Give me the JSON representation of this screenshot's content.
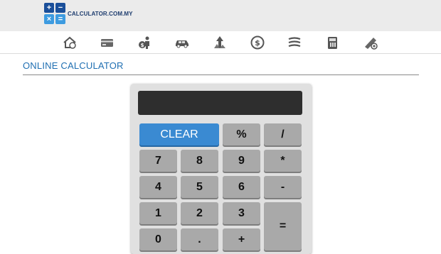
{
  "header": {
    "logo_symbols": [
      "+",
      "−",
      "×",
      "="
    ],
    "logo_text": "CALCULATOR.COM.MY",
    "colors": {
      "brand_dark": "#1a4f9a",
      "brand_light": "#3d9be0"
    }
  },
  "nav_icons": [
    "home-icon",
    "credit-card-icon",
    "salary-icon",
    "car-icon",
    "property-icon",
    "currency-icon",
    "road-tax-icon",
    "gas-station-icon",
    "loan-calculator-icon"
  ],
  "section": {
    "title": "ONLINE CALCULATOR"
  },
  "calculator": {
    "display": "",
    "keys": {
      "clear": "CLEAR",
      "percent": "%",
      "divide": "/",
      "seven": "7",
      "eight": "8",
      "nine": "9",
      "multiply": "*",
      "four": "4",
      "five": "5",
      "six": "6",
      "minus": "-",
      "one": "1",
      "two": "2",
      "three": "3",
      "equals": "=",
      "zero": "0",
      "dot": ".",
      "plus": "+"
    },
    "colors": {
      "key": "#a9a9a9",
      "clear": "#3a8ad2",
      "display": "#2e2e2e"
    }
  }
}
